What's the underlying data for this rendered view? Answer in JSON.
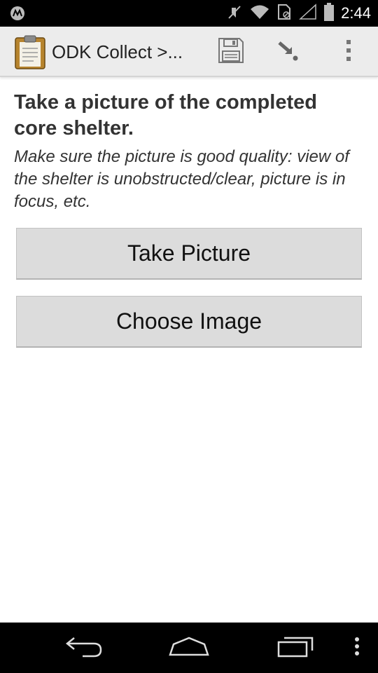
{
  "status_bar": {
    "time": "2:44",
    "icons": [
      "motorola-logo-icon",
      "mute-icon",
      "wifi-icon",
      "sim-no-service-icon",
      "signal-icon",
      "battery-icon"
    ]
  },
  "action_bar": {
    "title": "ODK Collect >...",
    "app_icon": "clipboard-icon",
    "save_icon": "save-icon",
    "goto_icon": "goto-icon",
    "overflow_icon": "overflow-menu-icon"
  },
  "question": {
    "label": "Take a picture of the completed core shelter.",
    "hint": "Make sure the picture is good quality: view of the shelter is unobstructed/clear, picture is in focus, etc."
  },
  "buttons": {
    "take_picture": "Take Picture",
    "choose_image": "Choose Image"
  },
  "nav_bar": {
    "icons": [
      "back-icon",
      "home-icon",
      "recent-apps-icon",
      "menu-icon"
    ]
  },
  "colors": {
    "status_bar_bg": "#000000",
    "action_bar_bg": "#ececec",
    "button_bg": "#dcdcdc",
    "text": "#333333"
  }
}
